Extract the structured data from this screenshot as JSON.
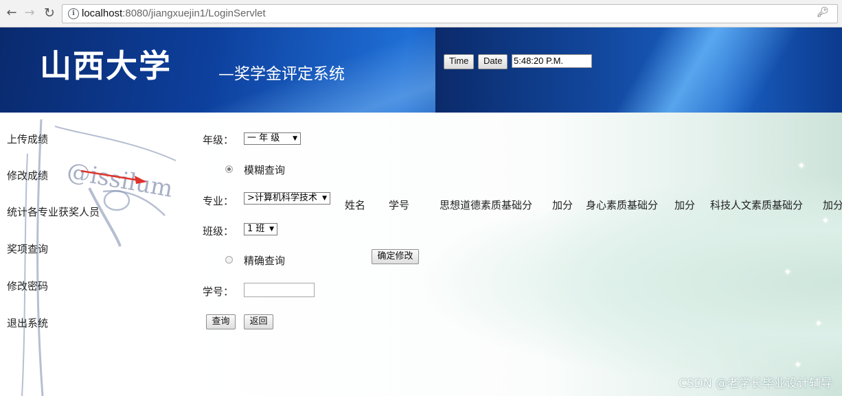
{
  "browser": {
    "url_host": "localhost",
    "url_rest": ":8080/jiangxuejin1/LoginServlet"
  },
  "header": {
    "university": "山西大学",
    "system_title": "—奖学金评定系统",
    "time_button": "Time",
    "date_button": "Date",
    "clock_value": "5:48:20 P.M."
  },
  "sidebar": {
    "items": [
      {
        "label": "上传成绩"
      },
      {
        "label": "修改成绩"
      },
      {
        "label": "统计各专业获奖人员"
      },
      {
        "label": "奖项查询"
      },
      {
        "label": "修改密码"
      },
      {
        "label": "退出系统"
      }
    ],
    "decor_text": "@issilum"
  },
  "form": {
    "grade_label": "年级：",
    "grade_value": "一  年  级",
    "fuzzy_label": "模糊查询",
    "major_label": "专业：",
    "major_value": ">计算机科学技术",
    "class_label": "班级：",
    "class_value": "1 班",
    "exact_label": "精确查询",
    "confirm_button": "确定修改",
    "student_id_label": "学号：",
    "student_id_value": "",
    "query_button": "查询",
    "back_button": "返回"
  },
  "table": {
    "columns": [
      "姓名",
      "学号",
      "思想道德素质基础分",
      "加分",
      "身心素质基础分",
      "加分",
      "科技人文素质基础分",
      "加分"
    ]
  },
  "watermark": "CSDN @老学长毕业设计辅导"
}
